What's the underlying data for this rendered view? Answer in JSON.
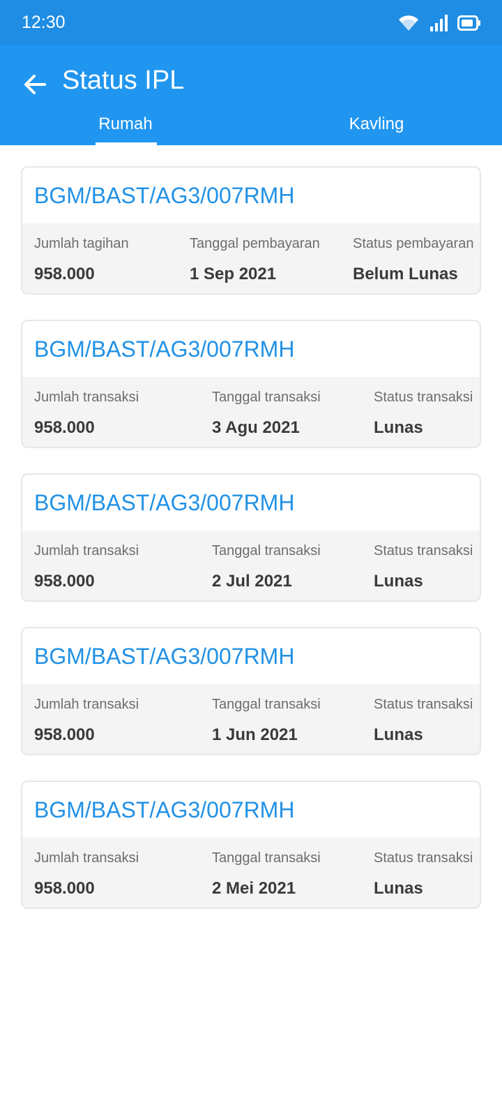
{
  "status_bar": {
    "time": "12:30"
  },
  "app_bar": {
    "title": "Status IPL",
    "tabs": [
      {
        "label": "Rumah",
        "active": true
      },
      {
        "label": "Kavling",
        "active": false
      }
    ]
  },
  "cards": [
    {
      "id": "BGM/BAST/AG3/007RMH",
      "labels": [
        "Jumlah tagihan",
        "Tanggal pembayaran",
        "Status pembayaran"
      ],
      "amount": "958.000",
      "date": "1 Sep 2021",
      "status": "Belum Lunas"
    },
    {
      "id": "BGM/BAST/AG3/007RMH",
      "labels": [
        "Jumlah transaksi",
        "Tanggal transaksi",
        "Status transaksi"
      ],
      "amount": "958.000",
      "date": "3 Agu 2021",
      "status": "Lunas"
    },
    {
      "id": "BGM/BAST/AG3/007RMH",
      "labels": [
        "Jumlah transaksi",
        "Tanggal transaksi",
        "Status transaksi"
      ],
      "amount": "958.000",
      "date": "2 Jul 2021",
      "status": "Lunas"
    },
    {
      "id": "BGM/BAST/AG3/007RMH",
      "labels": [
        "Jumlah transaksi",
        "Tanggal transaksi",
        "Status transaksi"
      ],
      "amount": "958.000",
      "date": "1 Jun 2021",
      "status": "Lunas"
    },
    {
      "id": "BGM/BAST/AG3/007RMH",
      "labels": [
        "Jumlah transaksi",
        "Tanggal transaksi",
        "Status transaksi"
      ],
      "amount": "958.000",
      "date": "2 Mei 2021",
      "status": "Lunas"
    }
  ],
  "colors": {
    "primary": "#2196f0",
    "status_bar": "#1f8de3",
    "paid": "#34d020",
    "unpaid": "#cc3b35",
    "link": "#2191e6"
  },
  "icons": [
    "wifi-icon",
    "signal-icon",
    "battery-icon",
    "back-arrow-icon"
  ]
}
